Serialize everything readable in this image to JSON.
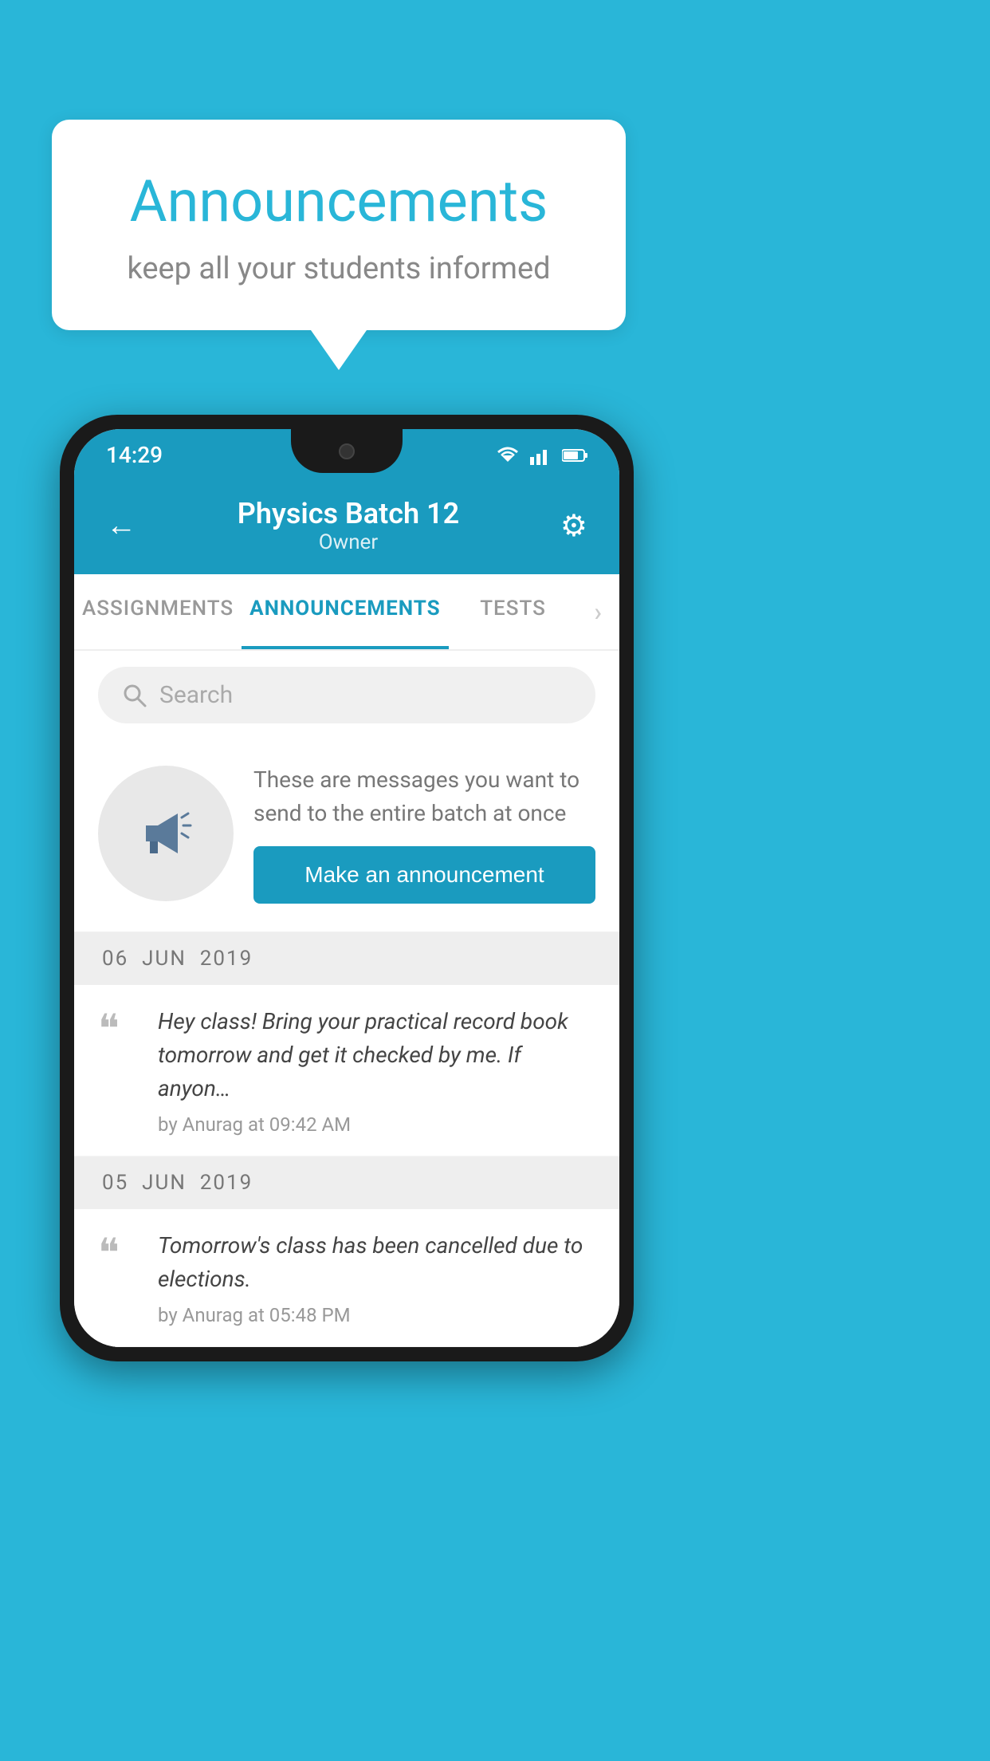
{
  "background": {
    "color": "#29b6d8"
  },
  "speechBubble": {
    "title": "Announcements",
    "subtitle": "keep all your students informed"
  },
  "phone": {
    "statusBar": {
      "time": "14:29"
    },
    "header": {
      "title": "Physics Batch 12",
      "subtitle": "Owner",
      "backLabel": "←",
      "gearLabel": "⚙"
    },
    "tabs": [
      {
        "label": "ASSIGNMENTS",
        "active": false
      },
      {
        "label": "ANNOUNCEMENTS",
        "active": true
      },
      {
        "label": "TESTS",
        "active": false
      },
      {
        "label": "…",
        "active": false
      }
    ],
    "search": {
      "placeholder": "Search"
    },
    "promo": {
      "description": "These are messages you want to send to the entire batch at once",
      "buttonLabel": "Make an announcement"
    },
    "announcements": [
      {
        "date": "06  JUN  2019",
        "items": [
          {
            "text": "Hey class! Bring your practical record book tomorrow and get it checked by me. If anyon…",
            "author": "by Anurag at 09:42 AM"
          }
        ]
      },
      {
        "date": "05  JUN  2019",
        "items": [
          {
            "text": "Tomorrow's class has been cancelled due to elections.",
            "author": "by Anurag at 05:48 PM"
          }
        ]
      }
    ]
  }
}
